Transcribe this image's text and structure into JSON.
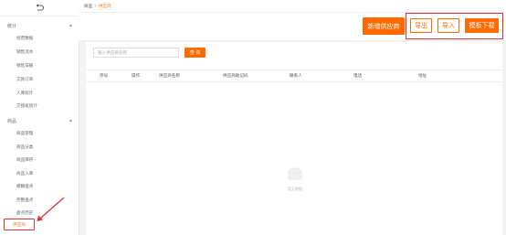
{
  "sidebar": {
    "groups": [
      {
        "label": "统计",
        "items": [
          "经营数据",
          "销售流水",
          "销售日报",
          "交款订单",
          "入库统计",
          "交接班统计"
        ]
      },
      {
        "label": "商品",
        "items": [
          "商品管理",
          "商品分类",
          "商品库存",
          "商品入库",
          "模糊盘点",
          "完整盘点",
          "盘点历史",
          "供应商"
        ]
      }
    ]
  },
  "breadcrumb": {
    "root": "商品",
    "separator": ">",
    "current": "供应商"
  },
  "actions": {
    "new_label": "新增供应商",
    "export_label": "导出",
    "import_label": "导入",
    "template_label": "模板下载"
  },
  "search": {
    "placeholder": "输入供应商名称",
    "button_label": "查 询"
  },
  "table": {
    "columns": [
      "序号",
      "操作",
      "供应商名称",
      "供应商助记码",
      "联系人",
      "电话",
      "地址"
    ]
  },
  "empty_text": "暂无数据",
  "colors": {
    "accent": "#ff6a00",
    "highlight": "#e53030"
  }
}
